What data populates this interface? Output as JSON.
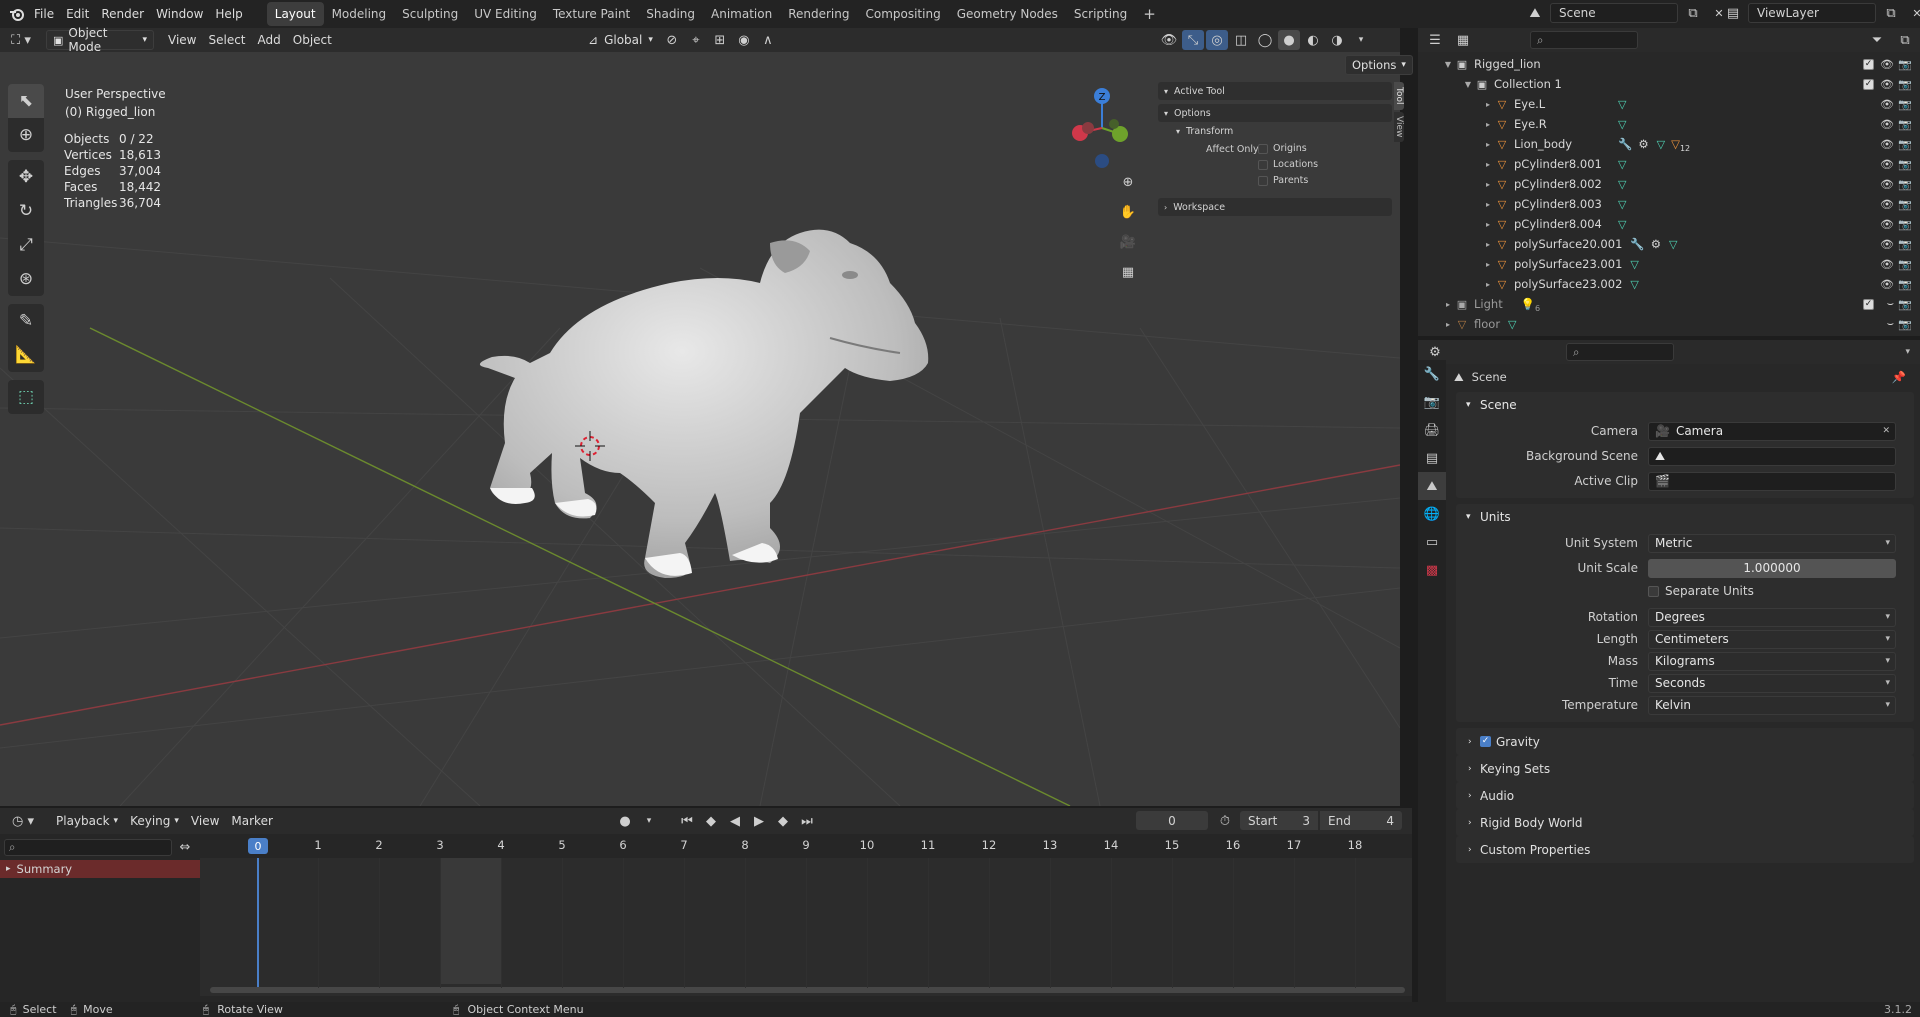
{
  "menu": [
    "File",
    "Edit",
    "Render",
    "Window",
    "Help"
  ],
  "workspaces": [
    "Layout",
    "Modeling",
    "Sculpting",
    "UV Editing",
    "Texture Paint",
    "Shading",
    "Animation",
    "Rendering",
    "Compositing",
    "Geometry Nodes",
    "Scripting"
  ],
  "workspace_add": "+",
  "scene_name": "Scene",
  "view_layer_name": "ViewLayer",
  "viewport": {
    "mode": "Object Mode",
    "menus": [
      "View",
      "Select",
      "Add",
      "Object"
    ],
    "orientation": "Global",
    "options_label": "Options",
    "perspective": "User Perspective",
    "active_label": "(0) Rigged_lion",
    "gizmo_axis": "Z",
    "stats": [
      {
        "label": "Objects",
        "value": "0 / 22"
      },
      {
        "label": "Vertices",
        "value": "18,613"
      },
      {
        "label": "Edges",
        "value": "37,004"
      },
      {
        "label": "Faces",
        "value": "18,442"
      },
      {
        "label": "Triangles",
        "value": "36,704"
      }
    ]
  },
  "npanel": {
    "active_tool": "Active Tool",
    "options": "Options",
    "transform": "Transform",
    "affect_only": "Affect Only",
    "checks": [
      "Origins",
      "Locations",
      "Parents"
    ],
    "workspace": "Workspace",
    "tabs": [
      "Tool",
      "View"
    ]
  },
  "outliner": {
    "root": "Rigged_lion",
    "collection": "Collection 1",
    "objects": [
      {
        "name": "Eye.L",
        "extra": ""
      },
      {
        "name": "Eye.R",
        "extra": ""
      },
      {
        "name": "Lion_body",
        "extra": "12"
      },
      {
        "name": "pCylinder8.001",
        "extra": ""
      },
      {
        "name": "pCylinder8.002",
        "extra": ""
      },
      {
        "name": "pCylinder8.003",
        "extra": ""
      },
      {
        "name": "pCylinder8.004",
        "extra": ""
      },
      {
        "name": "polySurface20.001",
        "extra": ""
      },
      {
        "name": "polySurface23.001",
        "extra": ""
      },
      {
        "name": "polySurface23.002",
        "extra": ""
      }
    ],
    "light": {
      "name": "Light",
      "extra": "6"
    },
    "floor": "floor"
  },
  "properties": {
    "header": "Scene",
    "scene_section": "Scene",
    "camera_label": "Camera",
    "camera_value": "Camera",
    "background_label": "Background Scene",
    "clip_label": "Active Clip",
    "units_section": "Units",
    "unit_system_label": "Unit System",
    "unit_system": "Metric",
    "unit_scale_label": "Unit Scale",
    "unit_scale": "1.000000",
    "separate_units": "Separate Units",
    "rotation_label": "Rotation",
    "rotation": "Degrees",
    "length_label": "Length",
    "length": "Centimeters",
    "mass_label": "Mass",
    "mass": "Kilograms",
    "time_label": "Time",
    "time": "Seconds",
    "temperature_label": "Temperature",
    "temperature": "Kelvin",
    "collapsed": [
      "Gravity",
      "Keying Sets",
      "Audio",
      "Rigid Body World",
      "Custom Properties"
    ]
  },
  "timeline": {
    "menus": [
      "Playback",
      "Keying",
      "View",
      "Marker"
    ],
    "current_frame": "0",
    "start_label": "Start",
    "start": "3",
    "end_label": "End",
    "end": "4",
    "frames": [
      "0",
      "1",
      "2",
      "3",
      "4",
      "5",
      "6",
      "7",
      "8",
      "9",
      "10",
      "11",
      "12",
      "13",
      "14",
      "15",
      "16",
      "17",
      "18"
    ],
    "summary": "Summary"
  },
  "status": {
    "select": "Select",
    "move": "Move",
    "rotate": "Rotate View",
    "context": "Object Context Menu",
    "version": "3.1.2"
  }
}
